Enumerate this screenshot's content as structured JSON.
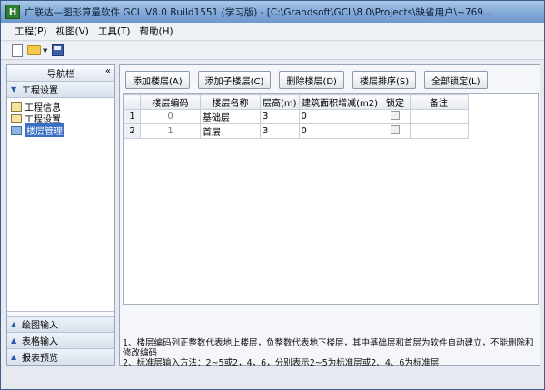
{
  "window": {
    "title": "广联达—图形算量软件 GCL V8.0 Build1551 (学习版) - [C:\\Grandsoft\\GCL\\8.0\\Projects\\缺省用户\\~769...",
    "icon_letter": "H"
  },
  "menu": [
    "工程(P)",
    "视图(V)",
    "工具(T)",
    "帮助(H)"
  ],
  "nav": {
    "header": "导航栏",
    "collapse": "«",
    "top_section": "工程设置",
    "tree": [
      {
        "label": "工程信息"
      },
      {
        "label": "工程设置"
      },
      {
        "label": "楼层管理",
        "selected": true
      }
    ],
    "bottom_sections": [
      "绘图输入",
      "表格输入",
      "报表预览"
    ]
  },
  "buttons": [
    "添加楼层(A)",
    "添加子楼层(C)",
    "删除楼层(D)",
    "楼层排序(S)",
    "全部锁定(L)"
  ],
  "grid": {
    "columns": [
      "",
      "楼层编码",
      "楼层名称",
      "层高(m)",
      "建筑面积增减(m2)",
      "锁定",
      "备注"
    ],
    "rows": [
      {
        "num": "1",
        "code": "0",
        "name": "基础层",
        "height": "3",
        "area": "0",
        "note": ""
      },
      {
        "num": "2",
        "code": "1",
        "name": "首层",
        "height": "3",
        "area": "0",
        "note": ""
      }
    ]
  },
  "notes": [
    "1、楼层编码列正整数代表地上楼层，负整数代表地下楼层，其中基础层和首层为软件自动建立，不能删除和修改编码",
    "2、标准层输入方法：2~5或2，4，6，分别表示2~5为标准层或2、4、6为标准层"
  ]
}
